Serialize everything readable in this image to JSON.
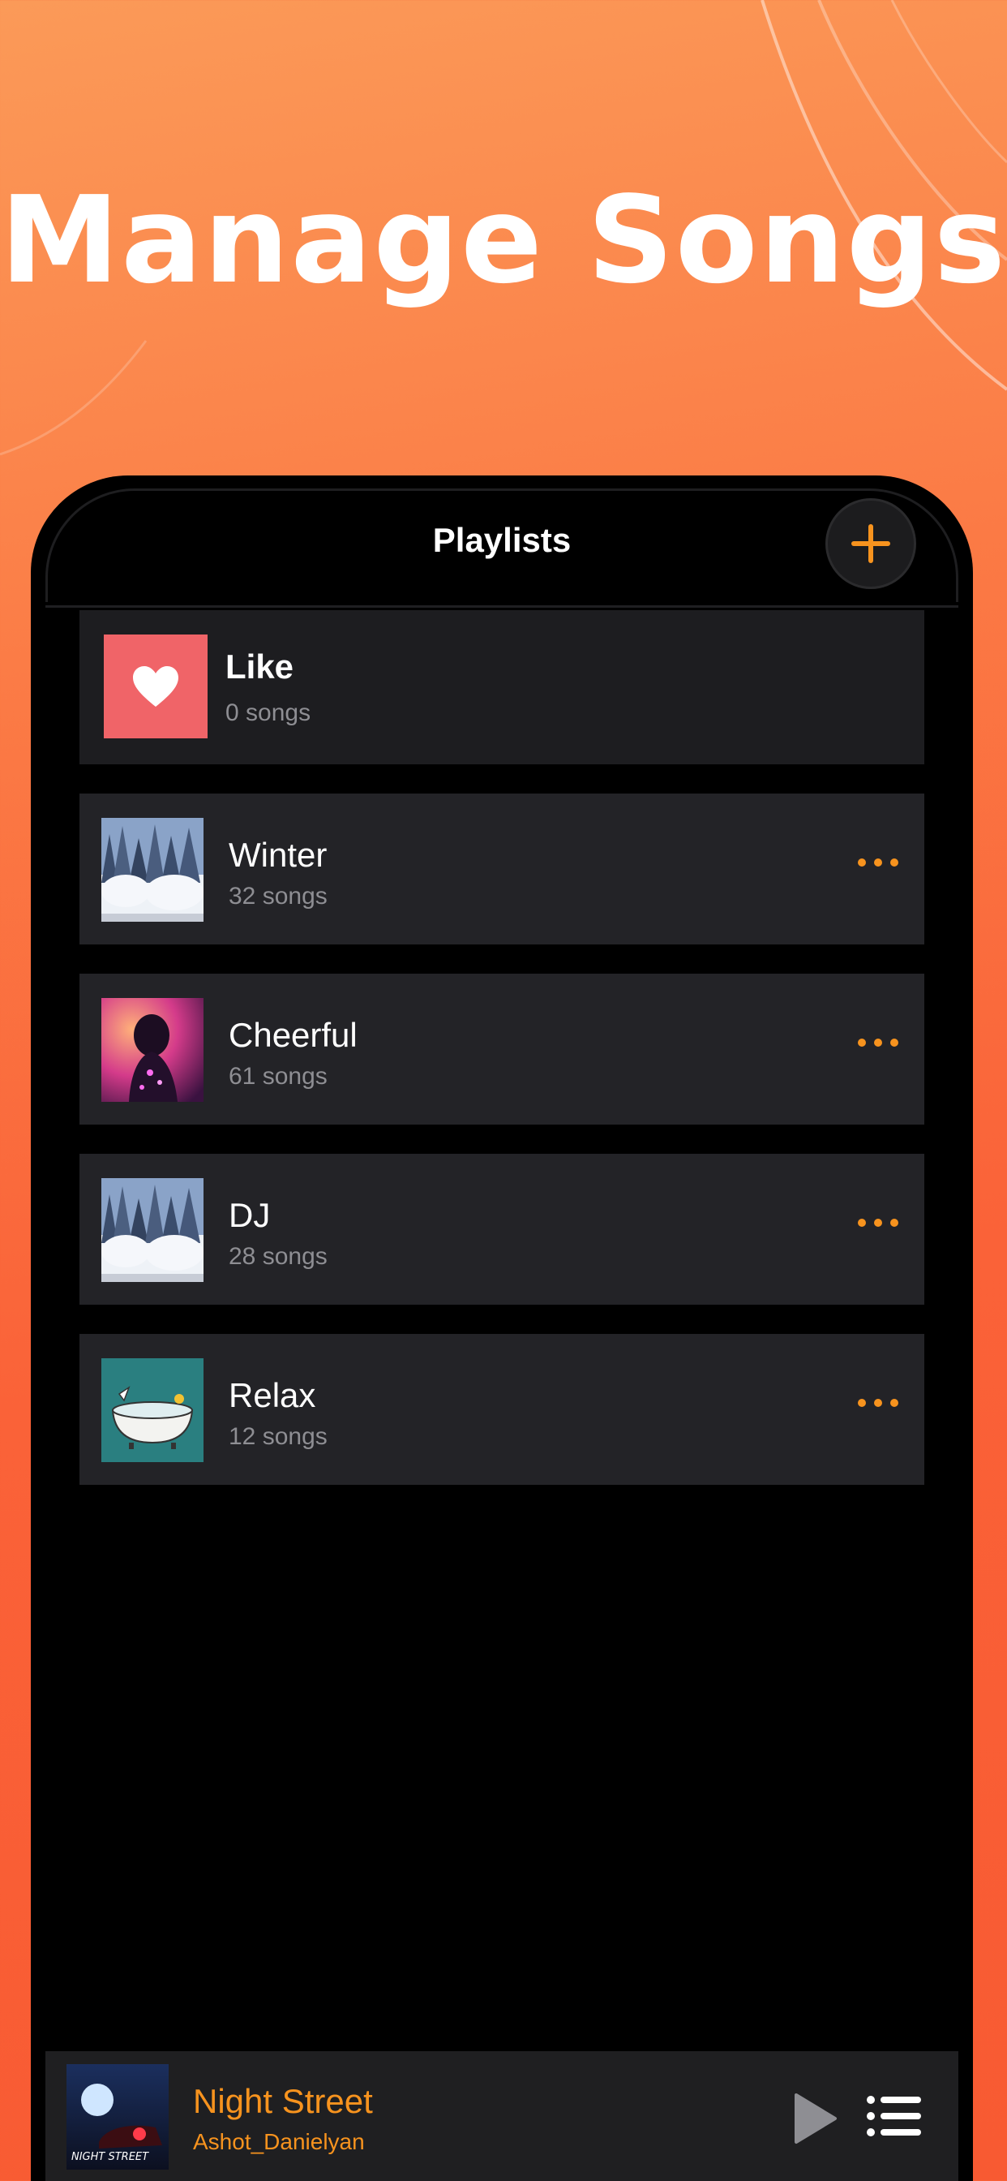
{
  "headline": "Manage Songs",
  "nav": {
    "title": "Playlists"
  },
  "like": {
    "title": "Like",
    "subtitle": "0 songs"
  },
  "playlists": [
    {
      "title": "Winter",
      "subtitle": "32 songs",
      "art": "snowy-forest"
    },
    {
      "title": "Cheerful",
      "subtitle": "61 songs",
      "art": "neon-dancer"
    },
    {
      "title": "DJ",
      "subtitle": "28 songs",
      "art": "snowy-forest"
    },
    {
      "title": "Relax",
      "subtitle": "12 songs",
      "art": "bathtub"
    }
  ],
  "player": {
    "title": "Night Street",
    "artist": "Ashot_Danielyan",
    "art_caption": "NIGHT STREET"
  },
  "colors": {
    "accent": "#f7931e",
    "background": "#000000",
    "row": "#232327",
    "like": "#f06468"
  },
  "icons": {
    "add": "plus-icon",
    "more": "ellipsis-icon",
    "play": "play-icon",
    "queue": "list-icon",
    "like": "heart-icon"
  }
}
